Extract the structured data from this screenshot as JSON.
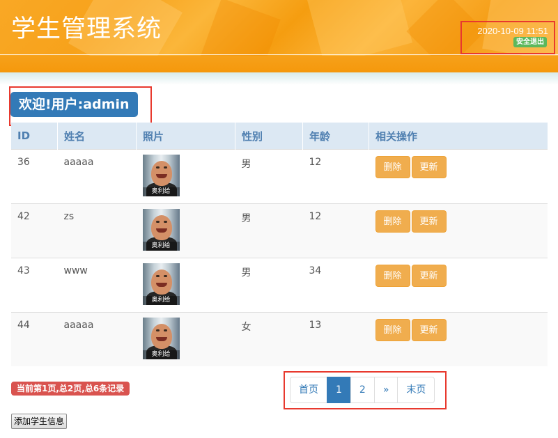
{
  "header": {
    "title": "学生管理系统",
    "datetime": "2020-10-09 11:51",
    "logout_label": "安全退出"
  },
  "welcome": "欢迎!用户:admin",
  "table": {
    "columns": [
      "ID",
      "姓名",
      "照片",
      "性别",
      "年龄",
      "相关操作"
    ],
    "rows": [
      {
        "id": "36",
        "name": "aaaaa",
        "photo_caption": "奥利给",
        "gender": "男",
        "age": "12"
      },
      {
        "id": "42",
        "name": "zs",
        "photo_caption": "奥利给",
        "gender": "男",
        "age": "12"
      },
      {
        "id": "43",
        "name": "www",
        "photo_caption": "奥利给",
        "gender": "男",
        "age": "34"
      },
      {
        "id": "44",
        "name": "aaaaa",
        "photo_caption": "奥利给",
        "gender": "女",
        "age": "13"
      }
    ],
    "delete_label": "删除",
    "update_label": "更新"
  },
  "footer": {
    "page_info": "当前第1页,总2页,总6条记录",
    "pagination": {
      "first": "首页",
      "pages": [
        "1",
        "2"
      ],
      "current": "1",
      "next": "»",
      "last": "末页"
    },
    "add_button": "添加学生信息"
  },
  "colors": {
    "header_orange": "#f7a21b",
    "primary": "#337ab7",
    "warning": "#f0ad4e",
    "danger": "#d9534f",
    "success": "#5cb85c",
    "highlight_border": "#e8392e"
  }
}
